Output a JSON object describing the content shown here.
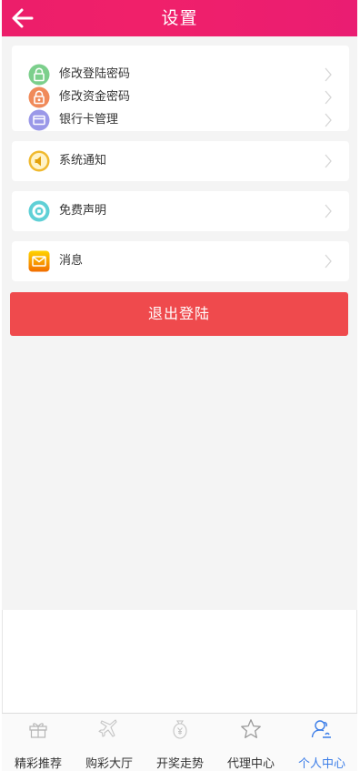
{
  "header": {
    "title": "设置",
    "back_icon": "arrow-left-icon"
  },
  "groups": [
    {
      "items": [
        {
          "label": "修改登陆密码",
          "icon": "lock-icon",
          "color": "#7ccf8c"
        },
        {
          "label": "修改资金密码",
          "icon": "lock-icon",
          "color": "#f08a5a"
        },
        {
          "label": "银行卡管理",
          "icon": "bank-card-icon",
          "color": "#9a98e8"
        }
      ]
    },
    {
      "items": [
        {
          "label": "系统通知",
          "icon": "speaker-icon",
          "color": "#f0b92e"
        }
      ]
    },
    {
      "items": [
        {
          "label": "免费声明",
          "icon": "disclaimer-icon",
          "color": "#5fd0d6"
        }
      ]
    },
    {
      "items": [
        {
          "label": "消息",
          "icon": "mail-icon",
          "color": "#f7b500"
        }
      ]
    }
  ],
  "logout_label": "退出登陆",
  "logout_color": "#ef4a4d",
  "header_color": "#ec1e6a",
  "tabbar": {
    "active_color": "#3b7de8",
    "tabs": [
      {
        "label": "精彩推荐",
        "icon": "gift-icon",
        "active": false
      },
      {
        "label": "购彩大厅",
        "icon": "plane-icon",
        "active": false
      },
      {
        "label": "开奖走势",
        "icon": "yen-bag-icon",
        "active": false
      },
      {
        "label": "代理中心",
        "icon": "star-icon",
        "active": false
      },
      {
        "label": "个人中心",
        "icon": "user-icon",
        "active": true
      }
    ]
  }
}
